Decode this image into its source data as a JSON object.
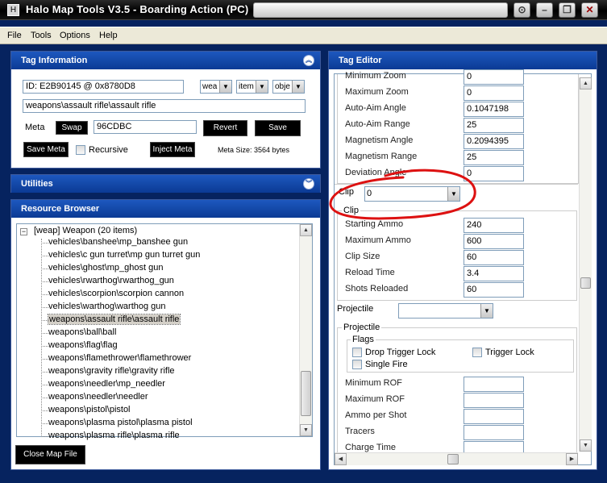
{
  "window": {
    "title": "Halo Map Tools V3.5 - Boarding Action (PC)",
    "app_icon_glyph": "H",
    "controls": {
      "help": "⊙",
      "minimize": "–",
      "restore": "❐",
      "close": "✕"
    }
  },
  "menu": [
    "File",
    "Tools",
    "Options",
    "Help"
  ],
  "tag_info": {
    "title": "Tag Information",
    "id_value": "ID: E2B90145 @ 0x8780D8",
    "type_selects": [
      "wea",
      "item",
      "obje"
    ],
    "path_value": "weapons\\assault rifle\\assault rifle",
    "meta_label": "Meta",
    "swap_label": "Swap",
    "meta_value": "96CDBC",
    "revert_label": "Revert",
    "save_label": "Save",
    "save_meta_label": "Save Meta",
    "recursive_label": "Recursive",
    "inject_label": "Inject Meta",
    "meta_size": "Meta Size: 3564 bytes"
  },
  "utilities": {
    "title": "Utilities"
  },
  "resource_browser": {
    "title": "Resource Browser",
    "root_label": "[weap] Weapon (20 items)",
    "items": [
      "vehicles\\banshee\\mp_banshee gun",
      "vehicles\\c gun turret\\mp gun turret gun",
      "vehicles\\ghost\\mp_ghost gun",
      "vehicles\\rwarthog\\rwarthog_gun",
      "vehicles\\scorpion\\scorpion cannon",
      "vehicles\\warthog\\warthog gun",
      "weapons\\assault rifle\\assault rifle",
      "weapons\\ball\\ball",
      "weapons\\flag\\flag",
      "weapons\\flamethrower\\flamethrower",
      "weapons\\gravity rifle\\gravity rifle",
      "weapons\\needler\\mp_needler",
      "weapons\\needler\\needler",
      "weapons\\pistol\\pistol",
      "weapons\\plasma pistol\\plasma pistol",
      "weapons\\plasma rifle\\plasma rifle"
    ],
    "selected_index": 6,
    "close_label": "Close Map File"
  },
  "tag_editor": {
    "title": "Tag Editor",
    "top_rows": [
      {
        "label": "Minimum Zoom",
        "value": "0"
      },
      {
        "label": "Maximum Zoom",
        "value": "0"
      },
      {
        "label": "Auto-Aim Angle",
        "value": "0.1047198"
      },
      {
        "label": "Auto-Aim Range",
        "value": "25"
      },
      {
        "label": "Magnetism Angle",
        "value": "0.2094395"
      },
      {
        "label": "Magnetism Range",
        "value": "25"
      },
      {
        "label": "Deviation Angle",
        "value": "0"
      }
    ],
    "clip_select_label": "Clip",
    "clip_select_value": "0",
    "clip_group_title": "Clip",
    "clip_rows": [
      {
        "label": "Starting Ammo",
        "value": "240"
      },
      {
        "label": "Maximum Ammo",
        "value": "600"
      },
      {
        "label": "Clip Size",
        "value": "60"
      },
      {
        "label": "Reload Time",
        "value": "3.4"
      },
      {
        "label": "Shots Reloaded",
        "value": "60"
      }
    ],
    "projectile_select_label": "Projectile",
    "projectile_select_value": "",
    "projectile_group_title": "Projectile",
    "flags_title": "Flags",
    "flags": [
      "Drop Trigger Lock",
      "Trigger Lock",
      "Single Fire"
    ],
    "bottom_rows": [
      {
        "label": "Minimum ROF",
        "value": ""
      },
      {
        "label": "Maximum ROF",
        "value": ""
      },
      {
        "label": "Ammo per Shot",
        "value": ""
      },
      {
        "label": "Tracers",
        "value": ""
      },
      {
        "label": "Charge Time",
        "value": ""
      }
    ]
  },
  "colors": {
    "annotation": "#dd1111",
    "header": "#1d58bf",
    "background": "#06235f"
  },
  "icons": {
    "up": "▲",
    "down": "▼",
    "left": "◀",
    "right": "▶",
    "collapse": "︽",
    "expand": "︾",
    "tree_toggle": "−",
    "select_arrow": "▼"
  }
}
